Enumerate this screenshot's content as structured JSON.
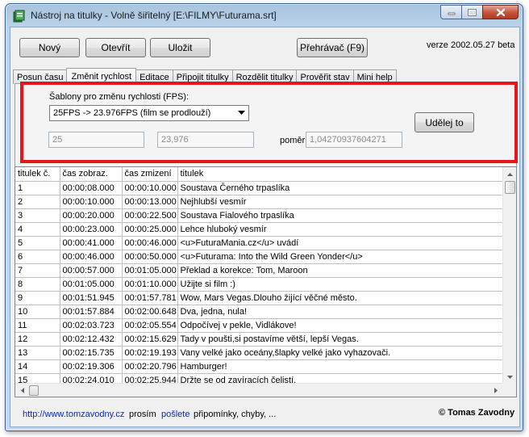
{
  "window": {
    "title": "Nástroj na titulky - Volně šiřitelný [E:\\FILMY\\Futurama.srt]",
    "icon": "app-icon"
  },
  "toolbar": {
    "new_label": "Nový",
    "open_label": "Otevřít",
    "save_label": "Uložit",
    "player_label": "Přehrávač (F9)",
    "version": "verze  2002.05.27 beta"
  },
  "tabs": [
    {
      "label": "Posun času",
      "active": false
    },
    {
      "label": "Změnit rychlost",
      "active": true
    },
    {
      "label": "Editace",
      "active": false
    },
    {
      "label": "Připojit titulky",
      "active": false
    },
    {
      "label": "Rozdělit titulky",
      "active": false
    },
    {
      "label": "Prověřit stav",
      "active": false
    },
    {
      "label": "Mini help",
      "active": false
    }
  ],
  "speed_panel": {
    "templates_label": "Šablony pro změnu rychlosti (FPS):",
    "template_selected": "25FPS -> 23.976FPS (film se prodlouží)",
    "fps_from": "25",
    "fps_to": "23,976",
    "ratio_label": "poměr",
    "ratio_value": "1,04270937604271",
    "apply_label": "Udělej to",
    "highlight_color": "#e8141a"
  },
  "subtitles": {
    "columns": [
      "titulek č.",
      "čas zobraz.",
      "čas zmizení",
      "titulek"
    ],
    "rows": [
      [
        "1",
        "00:00:08.000",
        "00:00:10.000",
        "Soustava Černého trpaslíka"
      ],
      [
        "2",
        "00:00:10.000",
        "00:00:13.000",
        "Nejhlubší vesmír"
      ],
      [
        "3",
        "00:00:20.000",
        "00:00:22.500",
        "Soustava Fialového trpaslíka"
      ],
      [
        "4",
        "00:00:23.000",
        "00:00:25.000",
        "Lehce hluboký vesmír"
      ],
      [
        "5",
        "00:00:41.000",
        "00:00:46.000",
        "<u>FuturaMania.cz</u> uvádí"
      ],
      [
        "6",
        "00:00:46.000",
        "00:00:50.000",
        "<u>Futurama: Into the Wild Green Yonder</u>"
      ],
      [
        "7",
        "00:00:57.000",
        "00:01:05.000",
        "Překlad a korekce: Tom, Maroon"
      ],
      [
        "8",
        "00:01:05.000",
        "00:01:10.000",
        "Užijte si film :)"
      ],
      [
        "9",
        "00:01:51.945",
        "00:01:57.781",
        "Wow, Mars Vegas.Dlouho žijící věčné město."
      ],
      [
        "10",
        "00:01:57.884",
        "00:02:00.648",
        "Dva, jedna, nula!"
      ],
      [
        "11",
        "00:02:03.723",
        "00:02:05.554",
        "Odpočívej v pekle, Vidlákove!"
      ],
      [
        "12",
        "00:02:12.432",
        "00:02:15.629",
        "Tady v poušti,si postavíme větší, lepší Vegas."
      ],
      [
        "13",
        "00:02:15.735",
        "00:02:19.193",
        "Vany velké jako oceány,šlapky velké jako vyhazovači."
      ],
      [
        "14",
        "00:02:19.306",
        "00:02:20.796",
        "Hamburger!"
      ],
      [
        "15",
        "00:02:24.010",
        "00:02:25.944",
        "Držte se od zavíracích čelistí."
      ]
    ]
  },
  "status": {
    "url": "http://www.tomzavodny.cz",
    "text_please": "prosím",
    "send_link": "pošlete",
    "text_rest": "připomínky, chyby, ...",
    "copyright": "© Tomas Zavodny",
    "link_color": "#0b2ca0"
  }
}
